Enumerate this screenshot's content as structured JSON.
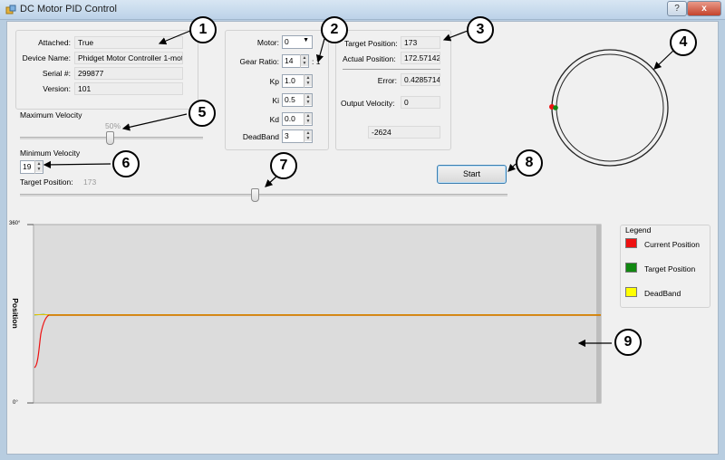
{
  "window": {
    "title": "DC Motor PID Control",
    "help_glyph": "?",
    "close_glyph": "x"
  },
  "device": {
    "attached_label": "Attached:",
    "attached_value": "True",
    "name_label": "Device Name:",
    "name_value": "Phidget Motor Controller 1-motc",
    "serial_label": "Serial #:",
    "serial_value": "299877",
    "version_label": "Version:",
    "version_value": "101"
  },
  "settings": {
    "motor_label": "Motor:",
    "motor_value": "0",
    "gear_ratio_label": "Gear Ratio:",
    "gear_ratio_value": "14",
    "gear_ratio_suffix": ": 1",
    "kp_label": "Kp",
    "kp_value": "1.0",
    "ki_label": "Ki",
    "ki_value": "0.5",
    "kd_label": "Kd",
    "kd_value": "0.0",
    "deadband_label": "DeadBand",
    "deadband_value": "3"
  },
  "status": {
    "target_label": "Target Position:",
    "target_value": "173",
    "actual_label": "Actual Position:",
    "actual_value": "172.57142",
    "error_label": "Error:",
    "error_value": "0.4285714",
    "output_label": "Output Velocity:",
    "output_value": "0",
    "raw_value": "-2624"
  },
  "controls": {
    "max_velocity_label": "Maximum Velocity",
    "max_velocity_value": "50%",
    "max_velocity_fraction": 0.5,
    "min_velocity_label": "Minimum Velocity",
    "min_velocity_value": "19",
    "target_position_label": "Target Position:",
    "target_position_value": "173",
    "target_position_fraction": 0.48,
    "start_label": "Start"
  },
  "graph": {
    "y_top_label": "360°",
    "y_bottom_label": "0°",
    "y_axis_title": "Position",
    "legend_title": "Legend",
    "legend": [
      {
        "name": "Current Position",
        "color": "#ee1111"
      },
      {
        "name": "Target Position",
        "color": "#118811"
      },
      {
        "name": "DeadBand",
        "color": "#ffff00"
      }
    ]
  },
  "callouts": [
    "1",
    "2",
    "3",
    "4",
    "5",
    "6",
    "7",
    "8",
    "9"
  ],
  "colors": {
    "current": "#ee1111",
    "target": "#118811",
    "deadband": "#ffff00",
    "flat_line": "#d08000",
    "graph_bg": "#dcdcdc"
  }
}
